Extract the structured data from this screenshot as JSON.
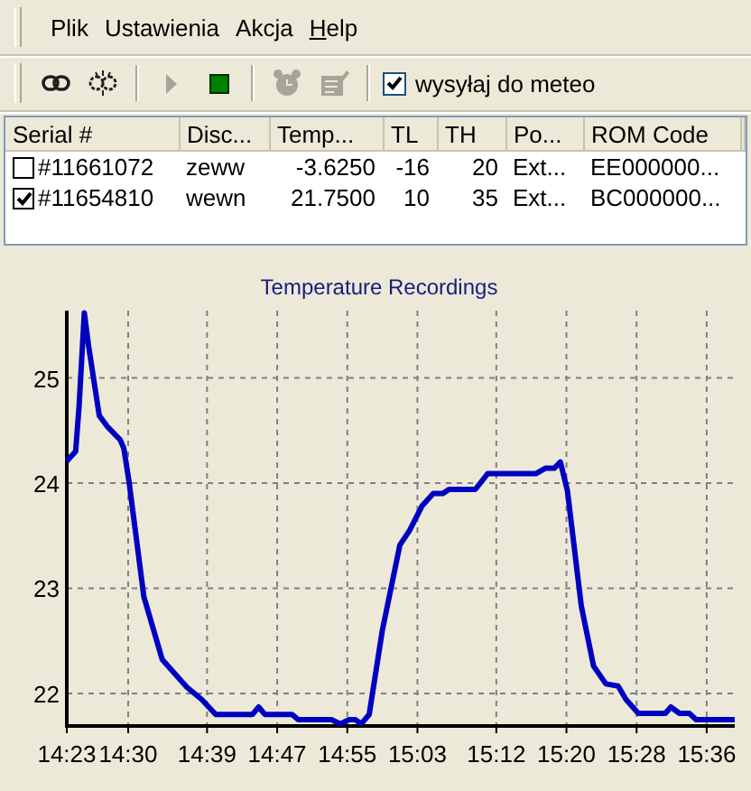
{
  "menu": [
    {
      "label": "Plik"
    },
    {
      "label": "Ustawienia"
    },
    {
      "label": "Akcja"
    },
    {
      "label": "Help",
      "underline_first": true
    }
  ],
  "toolbar": {
    "groups": [
      [
        {
          "kind": "link",
          "disabled": false
        },
        {
          "kind": "unlink",
          "disabled": false
        }
      ],
      [
        {
          "kind": "play",
          "disabled": true
        },
        {
          "kind": "stop",
          "disabled": false
        }
      ],
      [
        {
          "kind": "alarm",
          "disabled": true
        },
        {
          "kind": "edit",
          "disabled": true
        }
      ]
    ],
    "checkbox": {
      "label": "wysyłaj do meteo",
      "checked": true
    }
  },
  "table": {
    "columns": [
      {
        "label": "Serial #"
      },
      {
        "label": "Disc..."
      },
      {
        "label": "Temp..."
      },
      {
        "label": "TL"
      },
      {
        "label": "TH"
      },
      {
        "label": "Po..."
      },
      {
        "label": "ROM Code"
      }
    ],
    "rows": [
      {
        "checked": false,
        "cells": [
          "#11661072",
          "zeww",
          "-3.6250",
          "-16",
          "20",
          "Ext...",
          "EE000000..."
        ]
      },
      {
        "checked": true,
        "cells": [
          "#11654810",
          "wewn",
          "21.7500",
          "10",
          "35",
          "Ext...",
          "BC000000..."
        ]
      }
    ]
  },
  "chart": {
    "chart_data": {
      "type": "line",
      "title": "Temperature Recordings",
      "grid": true,
      "x": [
        863,
        864.0,
        864.4,
        865.0,
        865.5,
        866.7,
        867.7,
        869.1,
        869.5,
        870.1,
        871.8,
        873.9,
        876.7,
        878.4,
        880.0,
        884.2,
        884.9,
        885.6,
        888.7,
        889.4,
        893.2,
        894.2,
        895.2,
        895.9,
        896.6,
        897.5,
        899.0,
        901.0,
        902.1,
        903.5,
        904.8,
        905.9,
        906.6,
        909.6,
        911.0,
        916.5,
        917.6,
        918.6,
        919.3,
        920.1,
        921.7,
        923.1,
        924.5,
        925.9,
        926.8,
        928.2,
        931.3,
        931.9,
        932.9,
        934.0,
        934.8,
        939.2
      ],
      "series": [
        {
          "color": "#0000c0",
          "values": [
            24.21,
            24.3,
            24.73,
            25.62,
            25.3,
            24.64,
            24.53,
            24.41,
            24.33,
            24.01,
            22.92,
            22.32,
            22.06,
            21.94,
            21.8,
            21.8,
            21.87,
            21.8,
            21.8,
            21.75,
            21.75,
            21.71,
            21.75,
            21.75,
            21.71,
            21.8,
            22.6,
            23.41,
            23.55,
            23.78,
            23.9,
            23.9,
            23.94,
            23.94,
            24.09,
            24.09,
            24.14,
            24.14,
            24.2,
            23.93,
            22.83,
            22.26,
            22.09,
            22.07,
            21.94,
            21.81,
            21.81,
            21.87,
            21.81,
            21.81,
            21.75,
            21.75
          ]
        }
      ],
      "xlim": [
        863,
        939.2
      ],
      "ylim": [
        21.69,
        25.64
      ],
      "xticks": [
        {
          "value": 863,
          "label": "14:23"
        },
        {
          "value": 870,
          "label": "14:30"
        },
        {
          "value": 879,
          "label": "14:39"
        },
        {
          "value": 887,
          "label": "14:47"
        },
        {
          "value": 895,
          "label": "14:55"
        },
        {
          "value": 903,
          "label": "15:03"
        },
        {
          "value": 912,
          "label": "15:12"
        },
        {
          "value": 920,
          "label": "15:20"
        },
        {
          "value": 928,
          "label": "15:28"
        },
        {
          "value": 936,
          "label": "15:36"
        }
      ],
      "yticks": [
        22,
        23,
        24,
        25
      ]
    }
  }
}
